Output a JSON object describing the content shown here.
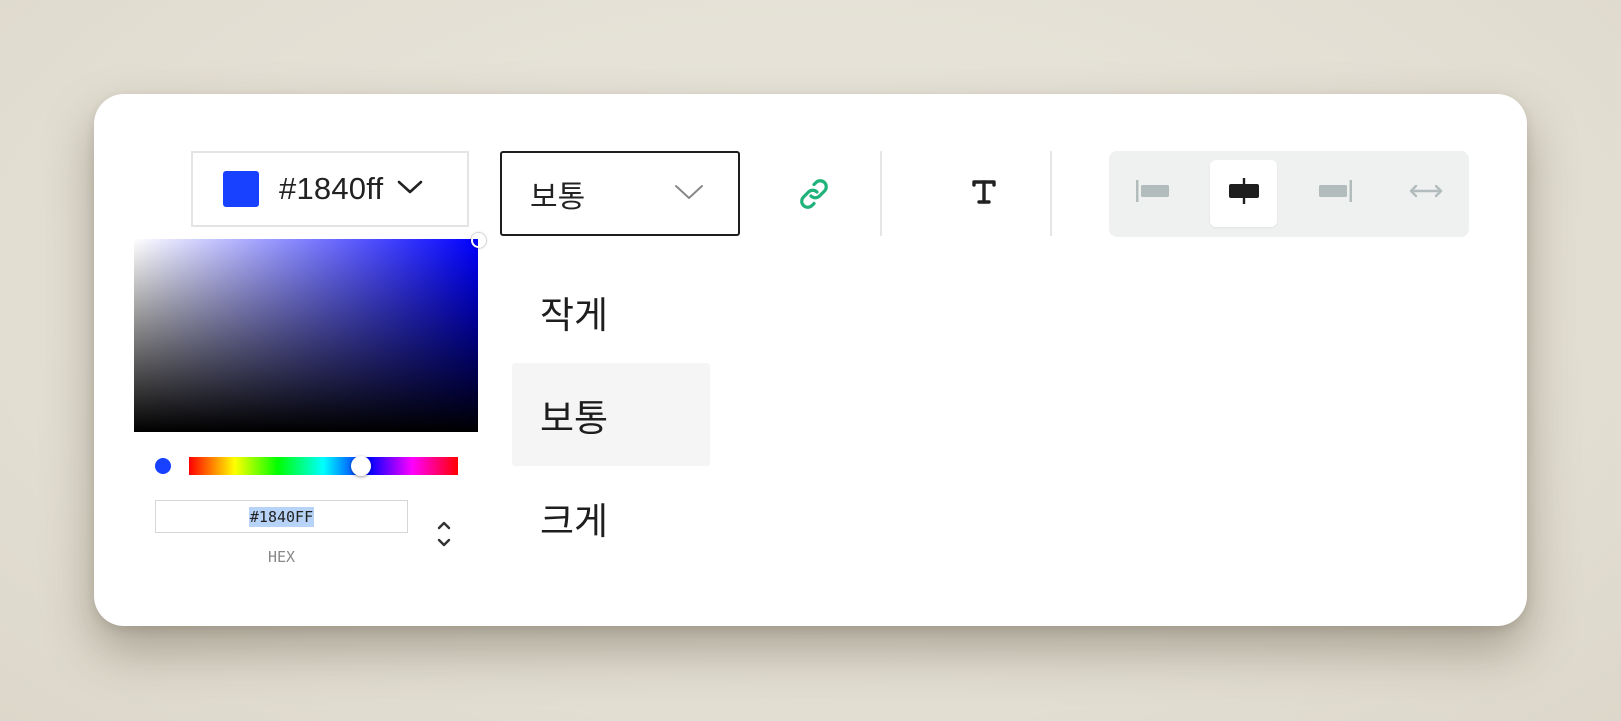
{
  "color": {
    "value": "#1840ff",
    "hex_upper": "#1840FF",
    "mode_label": "HEX",
    "hue_fraction": 0.64,
    "accent": "#1840ff"
  },
  "size": {
    "selected": "보통",
    "options": [
      {
        "label": "작게",
        "active": false
      },
      {
        "label": "보통",
        "active": true
      },
      {
        "label": "크게",
        "active": false
      }
    ]
  },
  "toolbar": {
    "link_color": "#1fb27a",
    "icons": [
      "chevron-down-icon",
      "link-icon",
      "text-icon",
      "align-left-icon",
      "align-center-icon",
      "align-right-icon",
      "full-width-icon"
    ]
  }
}
